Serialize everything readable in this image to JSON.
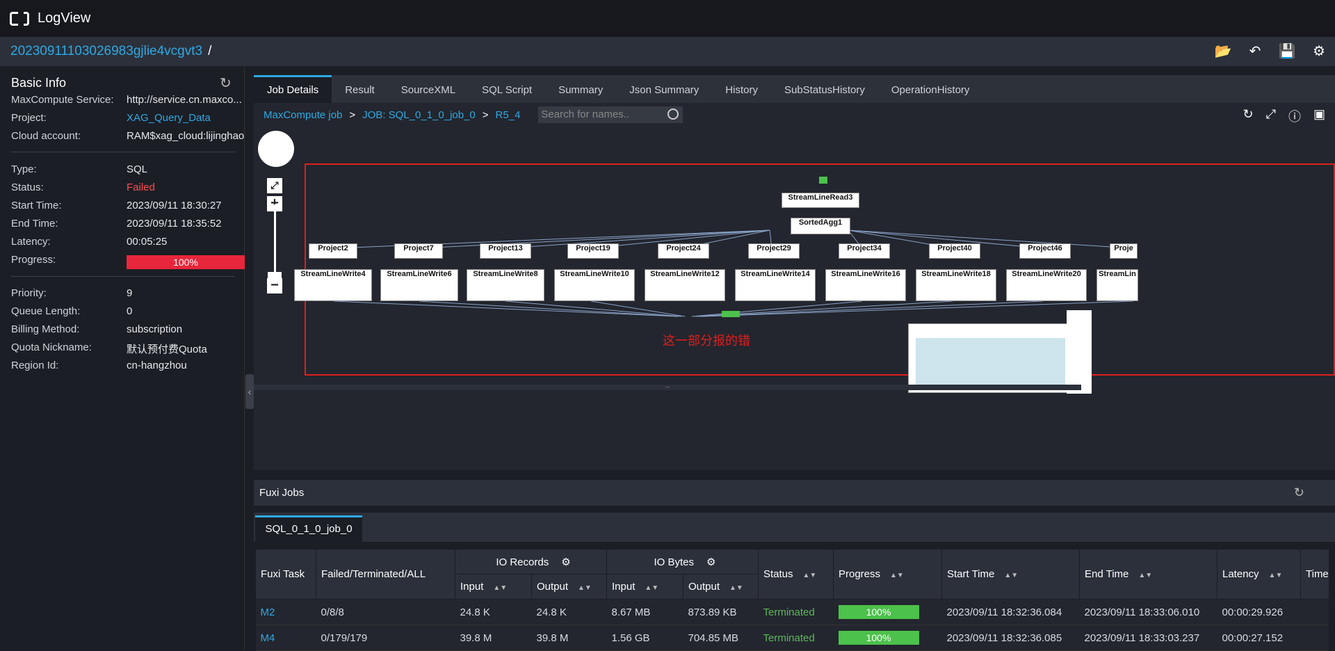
{
  "app": {
    "title": "LogView"
  },
  "job_id": "20230911103026983gjlie4vcgvt3",
  "slash": "/",
  "basic_info": {
    "title": "Basic Info",
    "rows": [
      {
        "k": "MaxCompute Service:",
        "v": "http://service.cn.maxco..."
      },
      {
        "k": "Project:",
        "v": "XAG_Query_Data"
      },
      {
        "k": "Cloud account:",
        "v": "RAM$xag_cloud:lijinghao"
      },
      {
        "k": "Type:",
        "v": "SQL"
      },
      {
        "k": "Status:",
        "v": "Failed"
      },
      {
        "k": "Start Time:",
        "v": "2023/09/11 18:30:27"
      },
      {
        "k": "End Time:",
        "v": "2023/09/11 18:35:52"
      },
      {
        "k": "Latency:",
        "v": "00:05:25"
      },
      {
        "k": "Progress:",
        "v": "100%"
      },
      {
        "k": "Priority:",
        "v": "9"
      },
      {
        "k": "Queue Length:",
        "v": "0"
      },
      {
        "k": "Billing Method:",
        "v": "subscription"
      },
      {
        "k": "Quota Nickname:",
        "v": "默认预付费Quota"
      },
      {
        "k": "Region Id:",
        "v": "cn-hangzhou"
      }
    ]
  },
  "tabs": [
    "Job Details",
    "Result",
    "SourceXML",
    "SQL Script",
    "Summary",
    "Json Summary",
    "History",
    "SubStatusHistory",
    "OperationHistory"
  ],
  "breadcrumbs": [
    "MaxCompute job",
    "JOB: SQL_0_1_0_job_0",
    "R5_4"
  ],
  "crumb_sep": ">",
  "search_placeholder": "Search for names..",
  "graph": {
    "top_node": "StreamLineRead3",
    "agg_node": "SortedAgg1",
    "projects": [
      "Project2",
      "Project7",
      "Project13",
      "Project19",
      "Project24",
      "Project29",
      "Project34",
      "Project40",
      "Project46",
      "Proje"
    ],
    "writes": [
      "StreamLineWrite4",
      "StreamLineWrite6",
      "StreamLineWrite8",
      "StreamLineWrite10",
      "StreamLineWrite12",
      "StreamLineWrite14",
      "StreamLineWrite16",
      "StreamLineWrite18",
      "StreamLineWrite20",
      "StreamLin"
    ]
  },
  "annotation": "这一部分报的错",
  "fuxi": {
    "title": "Fuxi Jobs",
    "tab": "SQL_0_1_0_job_0",
    "headers": {
      "task": "Fuxi Task",
      "fta": "Failed/Terminated/ALL",
      "io_records": "IO Records",
      "io_bytes": "IO Bytes",
      "input": "Input",
      "output": "Output",
      "status": "Status",
      "progress": "Progress",
      "start": "Start Time",
      "end": "End Time",
      "latency": "Latency",
      "time": "Time"
    },
    "rows": [
      {
        "task": "M2",
        "fta": "0/8/8",
        "rin": "24.8 K",
        "rout": "24.8 K",
        "bin": "8.67 MB",
        "bout": "873.89 KB",
        "status": "Terminated",
        "progress": "100%",
        "start": "2023/09/11 18:32:36.084",
        "end": "2023/09/11 18:33:06.010",
        "latency": "00:00:29.926"
      },
      {
        "task": "M4",
        "fta": "0/179/179",
        "rin": "39.8 M",
        "rout": "39.8 M",
        "bin": "1.56 GB",
        "bout": "704.85 MB",
        "status": "Terminated",
        "progress": "100%",
        "start": "2023/09/11 18:32:36.085",
        "end": "2023/09/11 18:33:03.237",
        "latency": "00:00:27.152"
      }
    ]
  }
}
